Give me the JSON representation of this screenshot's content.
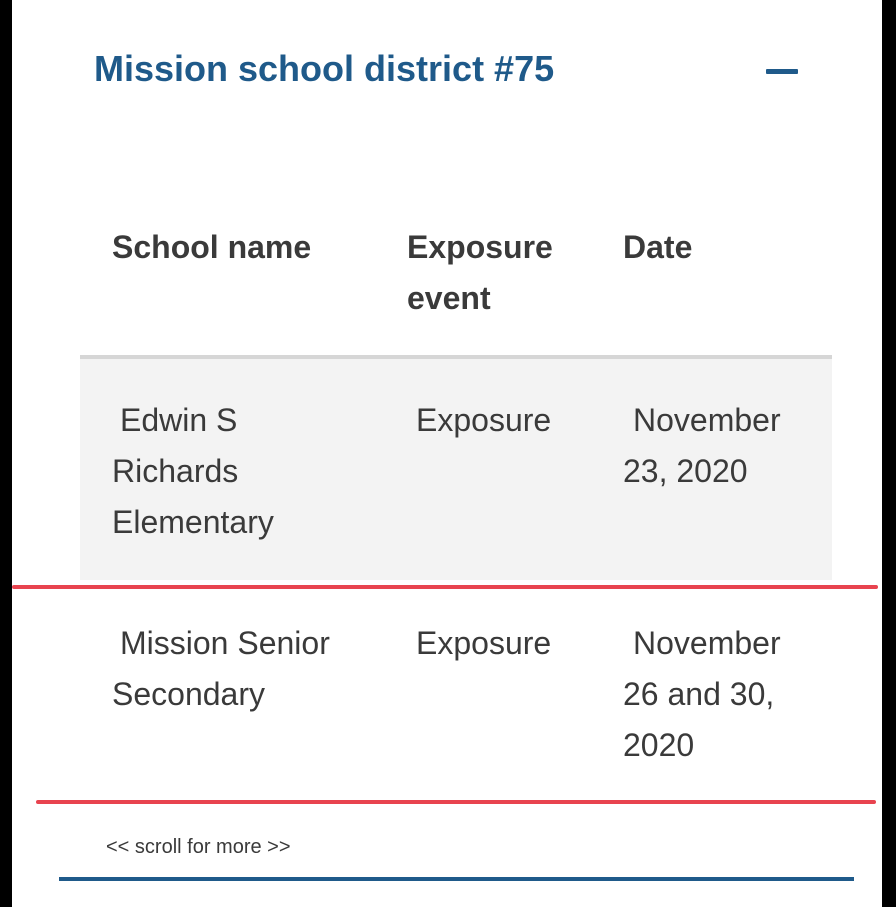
{
  "section": {
    "title": "Mission school district #75",
    "collapse_icon": "minus-icon"
  },
  "table": {
    "headers": [
      "School name",
      "Exposure event",
      "Date"
    ],
    "rows": [
      {
        "school": "Edwin S Richards Elementary",
        "event": "Exposure",
        "date": "November 23, 2020"
      },
      {
        "school": "Mission Senior Secondary",
        "event": "Exposure",
        "date": "November 26 and 30, 2020"
      }
    ]
  },
  "scroll_hint": "<< scroll for more >>",
  "colors": {
    "accent": "#1f5a8a",
    "annotation_red": "#e8434f",
    "row_shade": "#f3f3f3"
  }
}
